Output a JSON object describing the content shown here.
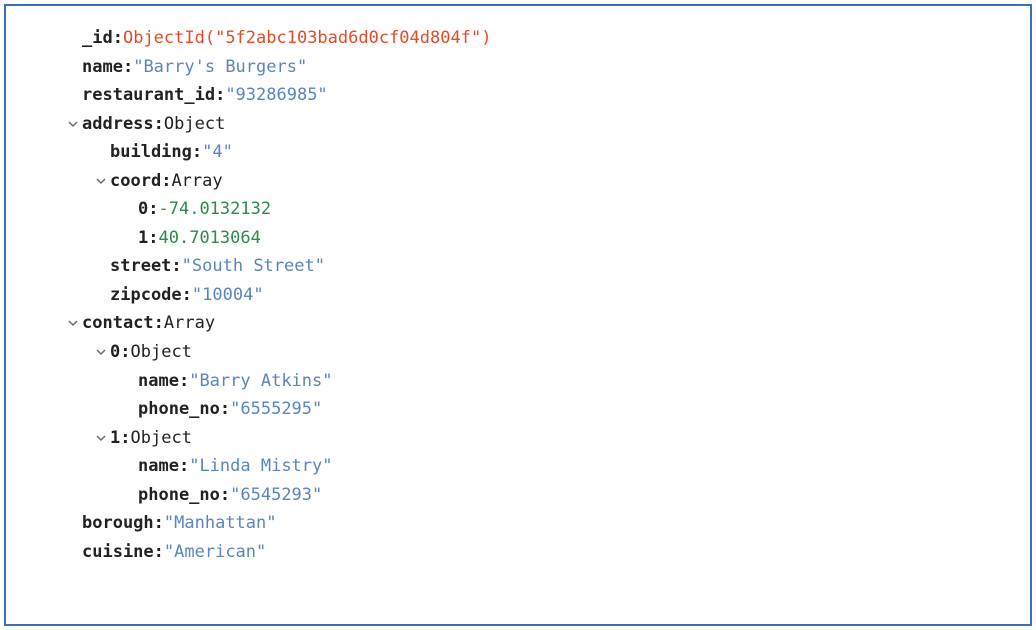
{
  "doc": {
    "id_key": "_id",
    "id_value": "ObjectId(\"5f2abc103bad6d0cf04d804f\")",
    "name_key": "name",
    "name_value": "\"Barry's Burgers\"",
    "restaurant_id_key": "restaurant_id",
    "restaurant_id_value": "\"93286985\"",
    "address_key": "address",
    "address_type": "Object",
    "building_key": "building",
    "building_value": "\"4\"",
    "coord_key": "coord",
    "coord_type": "Array",
    "coord_0_key": "0",
    "coord_0_value": "-74.0132132",
    "coord_1_key": "1",
    "coord_1_value": "40.7013064",
    "street_key": "street",
    "street_value": "\"South Street\"",
    "zipcode_key": "zipcode",
    "zipcode_value": "\"10004\"",
    "contact_key": "contact",
    "contact_type": "Array",
    "contact_0_key": "0",
    "contact_0_type": "Object",
    "contact_0_name_key": "name",
    "contact_0_name_value": "\"Barry Atkins\"",
    "contact_0_phone_key": "phone_no",
    "contact_0_phone_value": "\"6555295\"",
    "contact_1_key": "1",
    "contact_1_type": "Object",
    "contact_1_name_key": "name",
    "contact_1_name_value": "\"Linda Mistry\"",
    "contact_1_phone_key": "phone_no",
    "contact_1_phone_value": "\"6545293\"",
    "borough_key": "borough",
    "borough_value": "\"Manhattan\"",
    "cuisine_key": "cuisine",
    "cuisine_value": "\"American\""
  },
  "colon": ":"
}
